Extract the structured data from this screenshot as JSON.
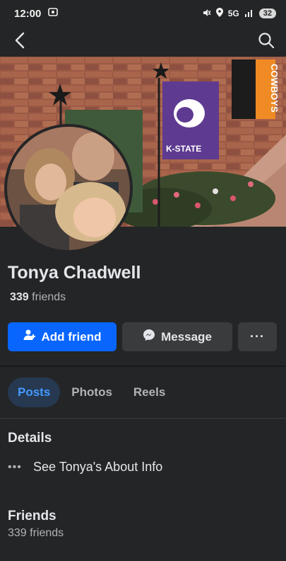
{
  "status_bar": {
    "time": "12:00",
    "network": "5G",
    "battery": "32"
  },
  "icons": {
    "back": "chevron-left-icon",
    "search": "search-icon",
    "add_friend": "add-person-icon",
    "message": "messenger-icon",
    "more": "more-horizontal-icon"
  },
  "cover": {
    "flag_text": "K-STATE",
    "banner_text": "COWBOYS"
  },
  "profile": {
    "name": "Tonya Chadwell",
    "friends_count": "339",
    "friends_suffix": "friends"
  },
  "actions": {
    "add_friend": "Add friend",
    "message": "Message",
    "more": "···"
  },
  "tabs": [
    {
      "label": "Posts",
      "active": true
    },
    {
      "label": "Photos",
      "active": false
    },
    {
      "label": "Reels",
      "active": false
    }
  ],
  "details": {
    "title": "Details",
    "about_label": "See Tonya's About Info"
  },
  "friends_section": {
    "title": "Friends",
    "count_text": "339 friends"
  },
  "colors": {
    "background": "#242526",
    "primary_blue": "#0866ff",
    "active_tab_bg": "#263951",
    "active_tab_text": "#4599ff",
    "secondary_button": "#3a3b3c"
  }
}
